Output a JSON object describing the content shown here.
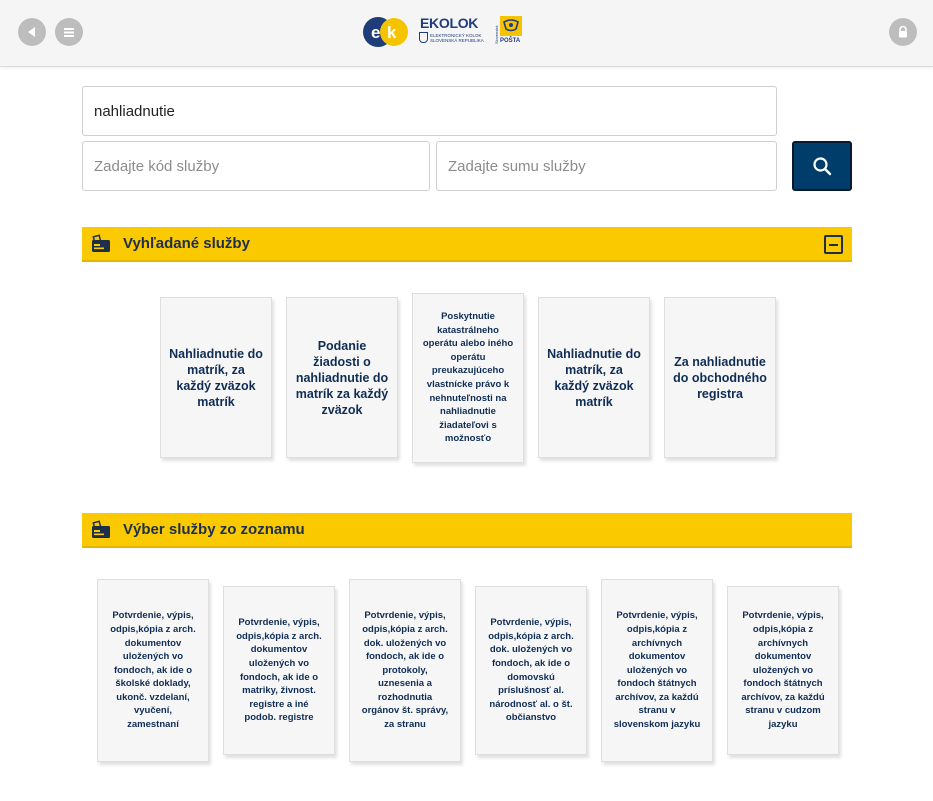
{
  "header": {
    "logo_text": "EKOLOK",
    "logo_sub1": "ELEKTRONICKÝ KOLOK",
    "logo_sub2": "SLOVENSKÁ REPUBLIKA",
    "posta_text": "POŠTA",
    "posta_side": "Slovenská",
    "icons": [
      "back-icon",
      "menu-icon",
      "lock-icon"
    ]
  },
  "search": {
    "main_value": "nahliadnutie",
    "code_placeholder": "Zadajte kód služby",
    "sum_placeholder": "Zadajte sumu služby",
    "button_icon": "search-icon"
  },
  "found_section": {
    "title": "Vyhľadané služby",
    "cards": [
      "Nahliadnutie do matrík, za každý zväzok matrík",
      "Podanie žiadosti o nahliadnutie do matrík za každý zväzok",
      "Poskytnutie katastrálneho operátu alebo iného operátu preukazujúceho vlastnícke právo k nehnuteľnosti na nahliadnutie žiadateľovi s možnosťo",
      "Nahliadnutie do matrík, za každý zväzok matrík",
      "Za nahliadnutie do obchodného registra"
    ]
  },
  "list_section": {
    "title": "Výber služby zo zoznamu",
    "cards": [
      "Potvrdenie, výpis, odpis,kópia z arch. dokumentov uložených vo fondoch, ak ide o školské doklady, ukonč. vzdelaní, vyučení, zamestnaní",
      "Potvrdenie, výpis, odpis,kópia z arch. dokumentov uložených vo fondoch, ak ide o matriky, živnost. registre a iné podob. registre",
      "Potvrdenie, výpis, odpis,kópia z arch. dok. uložených vo fondoch, ak ide o protokoly, uznesenia a rozhodnutia orgánov št. správy, za stranu",
      "Potvrdenie, výpis, odpis,kópia z arch. dok. uložených vo fondoch, ak ide o domovskú príslušnosť al. národnosť al. o št. občianstvo",
      "Potvrdenie, výpis, odpis,kópia z archívnych dokumentov uložených vo fondoch štátnych archívov, za každú stranu v slovenskom jazyku",
      "Potvrdenie, výpis, odpis,kópia z archívnych dokumentov uložených vo fondoch štátnych archívov, za každú stranu v cudzom jazyku"
    ]
  },
  "colors": {
    "accent_yellow": "#fbc900",
    "navy": "#003d6b",
    "card_text": "#0f2d55"
  }
}
